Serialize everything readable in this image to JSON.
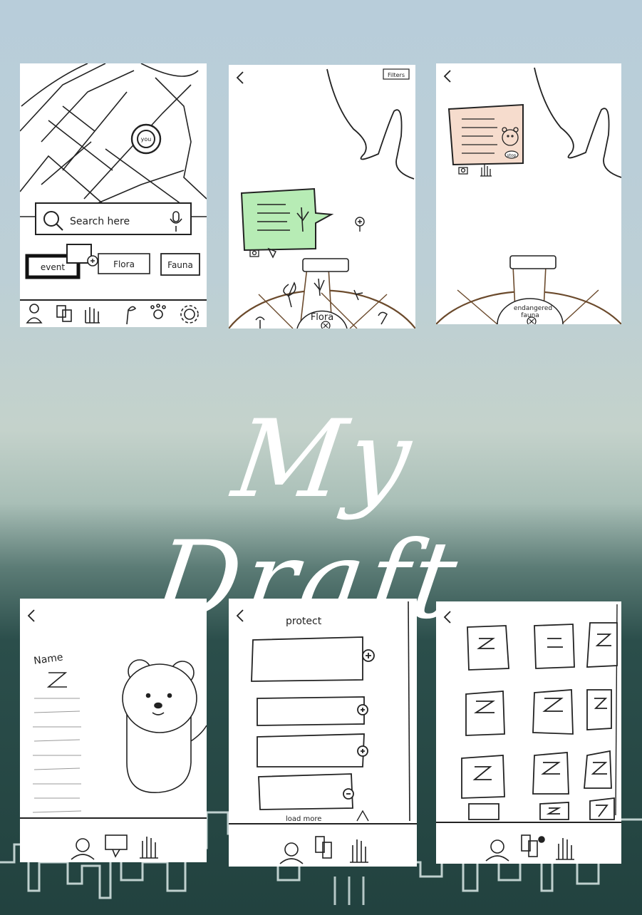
{
  "title": "My Draft",
  "panel1": {
    "map_pin_label": "you",
    "search_placeholder": "Search here",
    "chips": [
      "event",
      "Flora",
      "Fauna"
    ]
  },
  "panel2": {
    "filter_label": "Filters",
    "wheel_label": "Flora"
  },
  "panel3": {
    "stop_label": "stop",
    "wheel_label_line1": "endangered",
    "wheel_label_line2": "fauna"
  },
  "panel4": {
    "name_label": "Name"
  },
  "panel5": {
    "heading": "protect",
    "load_more": "load  more"
  },
  "colors": {
    "note_green": "#b7ecb5",
    "note_peach": "#f6dccd",
    "stroke": "#222222",
    "wheel_stroke": "#6b4a2c"
  }
}
